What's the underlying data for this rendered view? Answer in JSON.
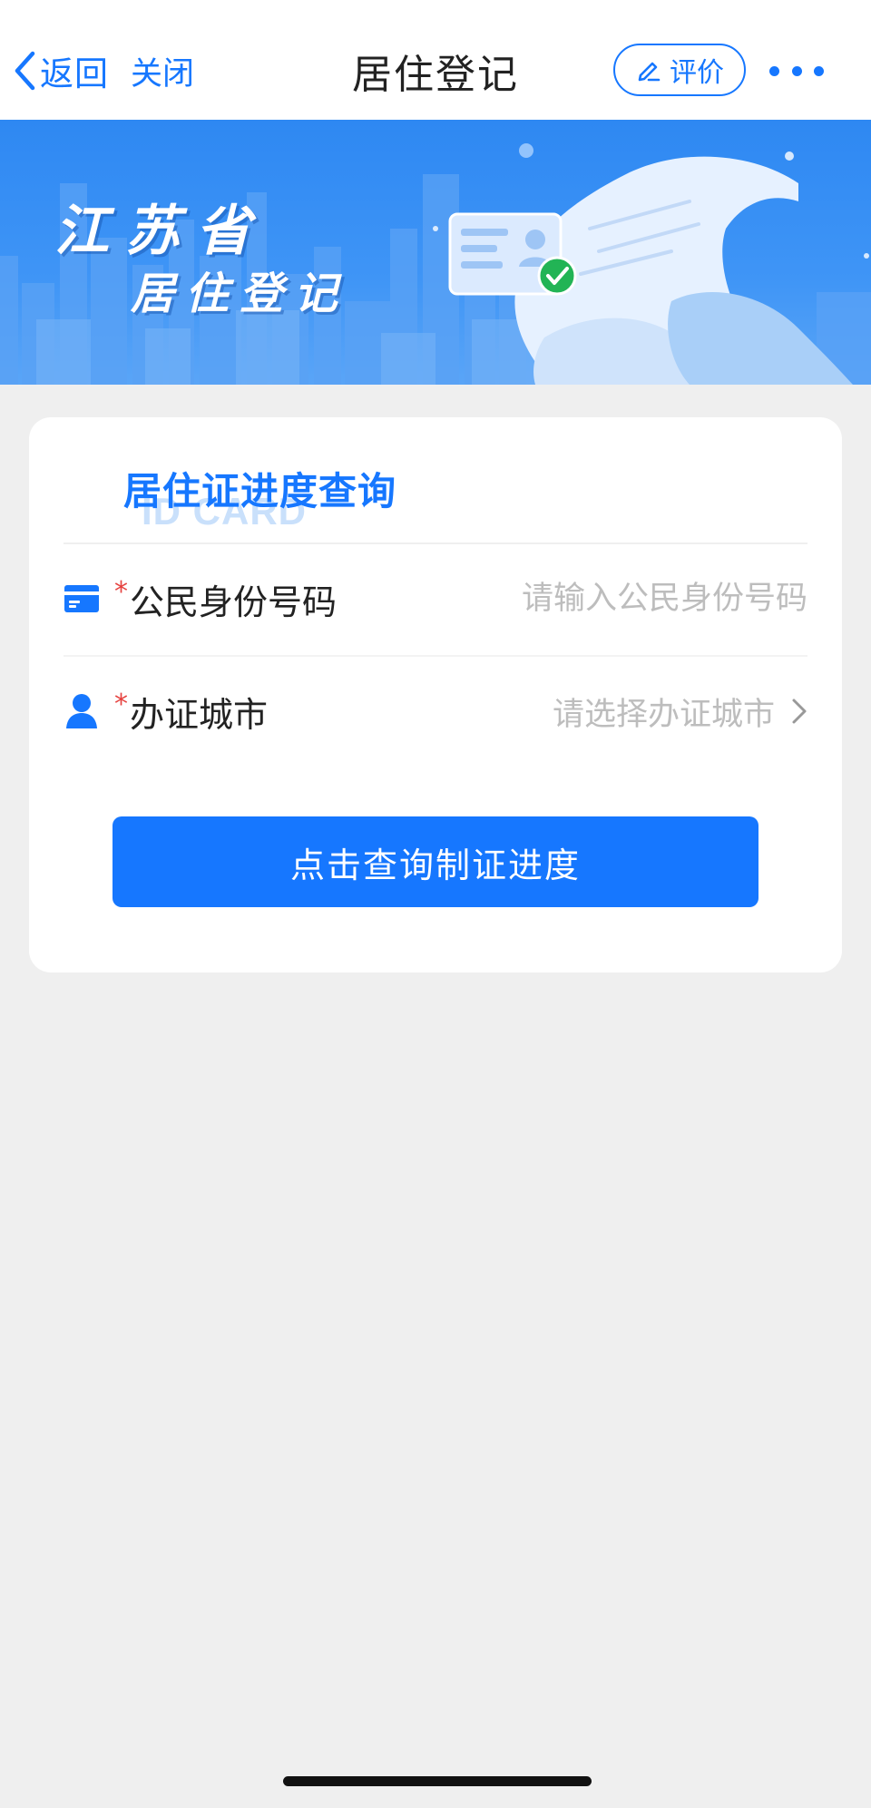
{
  "nav": {
    "back_label": "返回",
    "close_label": "关闭",
    "title": "居住登记",
    "rate_label": "评价"
  },
  "banner": {
    "province": "江苏省",
    "subtitle": "居住登记"
  },
  "card": {
    "title": "居住证进度查询",
    "watermark": "ID CARD",
    "fields": [
      {
        "label": "公民身份号码",
        "required_mark": "*",
        "placeholder": "请输入公民身份号码",
        "value": ""
      },
      {
        "label": "办证城市",
        "required_mark": "*",
        "placeholder": "请选择办证城市"
      }
    ],
    "submit_label": "点击查询制证进度"
  },
  "colors": {
    "accent": "#1677ff",
    "required": "#e64340",
    "placeholder": "#bdbdbd",
    "background": "#efefef"
  },
  "icons": {
    "back": "chevron-left-icon",
    "rate": "pencil-icon",
    "more": "more-dots-icon",
    "id_field": "id-card-icon",
    "city_field": "person-icon",
    "select": "chevron-right-icon"
  }
}
